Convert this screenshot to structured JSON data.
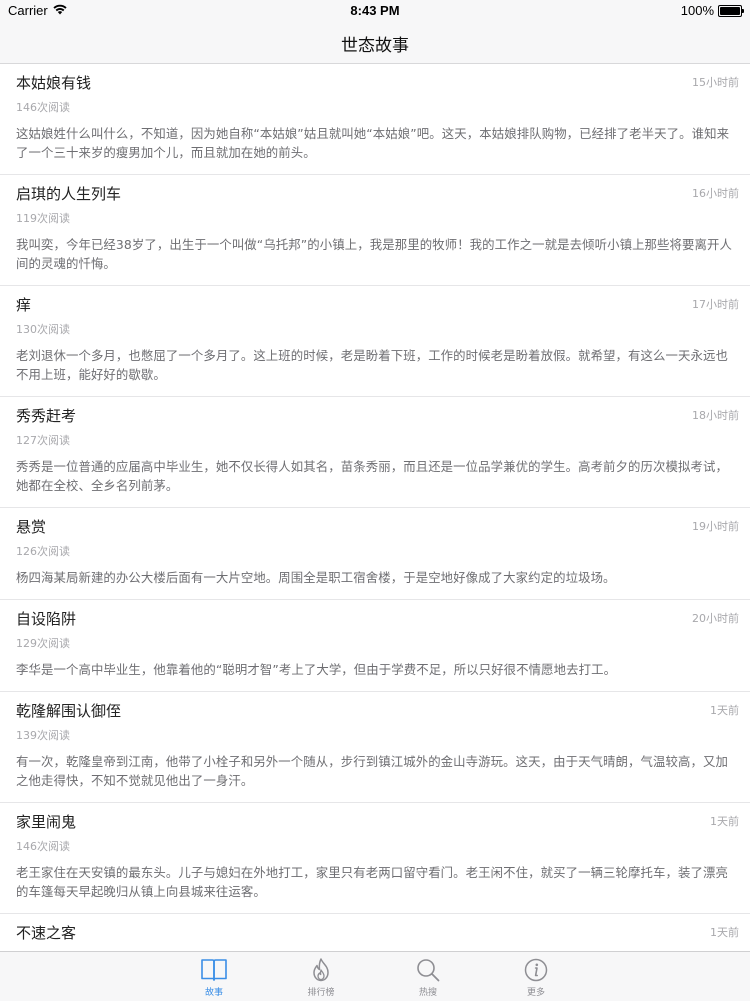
{
  "status": {
    "carrier": "Carrier",
    "time": "8:43 PM",
    "battery": "100%"
  },
  "nav": {
    "title": "世态故事"
  },
  "stories": [
    {
      "title": "本姑娘有钱",
      "time": "15小时前",
      "reads": "146次阅读",
      "summary": "这姑娘姓什么叫什么，不知道，因为她自称“本姑娘”姑且就叫她“本姑娘”吧。这天，本姑娘排队购物，已经排了老半天了。谁知来了一个三十来岁的瘦男加个儿，而且就加在她的前头。"
    },
    {
      "title": "启琪的人生列车",
      "time": "16小时前",
      "reads": "119次阅读",
      "summary": "我叫奕，今年已经38岁了，出生于一个叫做“乌托邦”的小镇上，我是那里的牧师！我的工作之一就是去倾听小镇上那些将要离开人间的灵魂的忏悔。"
    },
    {
      "title": "痒",
      "time": "17小时前",
      "reads": "130次阅读",
      "summary": "老刘退休一个多月，也憋屈了一个多月了。这上班的时候，老是盼着下班，工作的时候老是盼着放假。就希望，有这么一天永远也不用上班，能好好的歇歇。"
    },
    {
      "title": "秀秀赶考",
      "time": "18小时前",
      "reads": "127次阅读",
      "summary": "秀秀是一位普通的应届高中毕业生，她不仅长得人如其名，苗条秀丽，而且还是一位品学兼优的学生。高考前夕的历次模拟考试，她都在全校、全乡名列前茅。"
    },
    {
      "title": "悬赏",
      "time": "19小时前",
      "reads": "126次阅读",
      "summary": "杨四海某局新建的办公大楼后面有一大片空地。周围全是职工宿舍楼，于是空地好像成了大家约定的垃圾场。"
    },
    {
      "title": "自设陷阱",
      "time": "20小时前",
      "reads": "129次阅读",
      "summary": "李华是一个高中毕业生，他靠着他的“聪明才智”考上了大学，但由于学费不足，所以只好很不情愿地去打工。"
    },
    {
      "title": "乾隆解围认御侄",
      "time": "1天前",
      "reads": "139次阅读",
      "summary": "有一次，乾隆皇帝到江南，他带了小栓子和另外一个随从，步行到镇江城外的金山寺游玩。这天，由于天气晴朗，气温较高，又加之他走得快，不知不觉就见他出了一身汗。"
    },
    {
      "title": "家里闹鬼",
      "time": "1天前",
      "reads": "146次阅读",
      "summary": "老王家住在天安镇的最东头。儿子与媳妇在外地打工，家里只有老两口留守看门。老王闲不住，就买了一辆三轮摩托车，装了漂亮的车篷每天早起晚归从镇上向县城来往运客。"
    },
    {
      "title": "不速之客",
      "time": "1天前",
      "reads": "",
      "summary": ""
    }
  ],
  "tabs": [
    {
      "label": "故事",
      "icon": "book-icon",
      "active": true
    },
    {
      "label": "排行榜",
      "icon": "flame-icon",
      "active": false
    },
    {
      "label": "热搜",
      "icon": "search-icon",
      "active": false
    },
    {
      "label": "更多",
      "icon": "info-icon",
      "active": false
    }
  ],
  "colors": {
    "accent": "#3a8ee6",
    "muted": "#a8a8ac",
    "summary": "#6e6e72"
  }
}
